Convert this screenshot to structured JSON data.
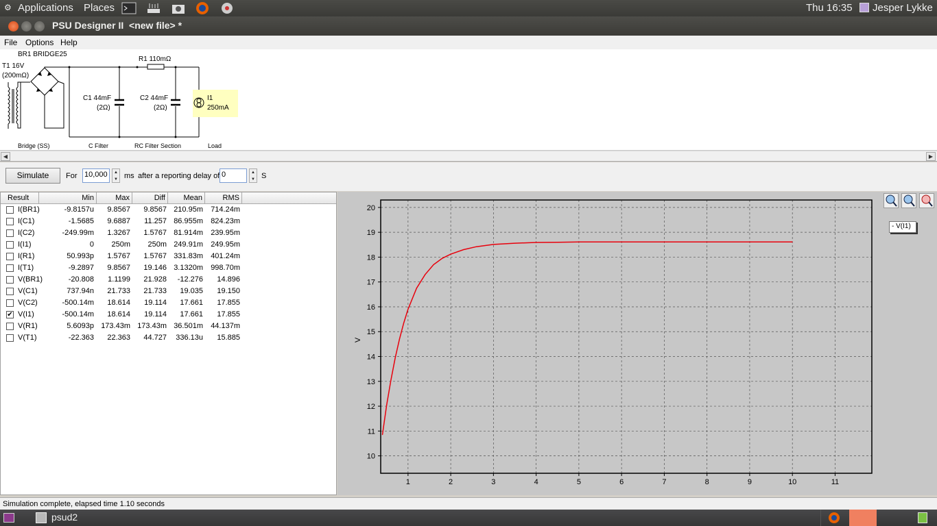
{
  "topbar": {
    "applications": "Applications",
    "places": "Places",
    "clock": "Thu 16:35",
    "user": "Jesper Lykke",
    "launchers": [
      "terminal-icon",
      "router-icon",
      "camera-icon",
      "firefox-icon",
      "gear-icon"
    ]
  },
  "window": {
    "title": "PSU Designer II  <new file> *"
  },
  "menu": {
    "file": "File",
    "options": "Options",
    "help": "Help"
  },
  "schematic": {
    "bridge_label": "BR1 BRIDGE25",
    "transformer_label": "T1 16V",
    "transformer_res": "(200mΩ)",
    "r1_label": "R1 110mΩ",
    "c1_label": "C1 44mF",
    "c1_res": "(2Ω)",
    "c2_label": "C2 44mF",
    "c2_res": "(2Ω)",
    "load_name": "I1",
    "load_value": "250mA",
    "section_bridge": "Bridge (SS)",
    "section_cfilter": "C Filter",
    "section_rc": "RC Filter Section",
    "section_load": "Load"
  },
  "sim": {
    "button": "Simulate",
    "for_label": "For",
    "duration": "10,000",
    "ms_label": "ms",
    "delay_label": "after a reporting delay of",
    "delay": "0",
    "s_label": "S"
  },
  "results": {
    "columns": [
      "Result",
      "Min",
      "Max",
      "Diff",
      "Mean",
      "RMS"
    ],
    "rows": [
      {
        "name": "I(BR1)",
        "min": "-9.8157u",
        "max": "9.8567",
        "diff": "9.8567",
        "mean": "210.95m",
        "rms": "714.24m",
        "checked": false
      },
      {
        "name": "I(C1)",
        "min": "-1.5685",
        "max": "9.6887",
        "diff": "11.257",
        "mean": "86.955m",
        "rms": "824.23m",
        "checked": false
      },
      {
        "name": "I(C2)",
        "min": "-249.99m",
        "max": "1.3267",
        "diff": "1.5767",
        "mean": "81.914m",
        "rms": "239.95m",
        "checked": false
      },
      {
        "name": "I(I1)",
        "min": "0",
        "max": "250m",
        "diff": "250m",
        "mean": "249.91m",
        "rms": "249.95m",
        "checked": false
      },
      {
        "name": "I(R1)",
        "min": "50.993p",
        "max": "1.5767",
        "diff": "1.5767",
        "mean": "331.83m",
        "rms": "401.24m",
        "checked": false
      },
      {
        "name": "I(T1)",
        "min": "-9.2897",
        "max": "9.8567",
        "diff": "19.146",
        "mean": "3.1320m",
        "rms": "998.70m",
        "checked": false
      },
      {
        "name": "V(BR1)",
        "min": "-20.808",
        "max": "1.1199",
        "diff": "21.928",
        "mean": "-12.276",
        "rms": "14.896",
        "checked": false
      },
      {
        "name": "V(C1)",
        "min": "737.94n",
        "max": "21.733",
        "diff": "21.733",
        "mean": "19.035",
        "rms": "19.150",
        "checked": false
      },
      {
        "name": "V(C2)",
        "min": "-500.14m",
        "max": "18.614",
        "diff": "19.114",
        "mean": "17.661",
        "rms": "17.855",
        "checked": false
      },
      {
        "name": "V(I1)",
        "min": "-500.14m",
        "max": "18.614",
        "diff": "19.114",
        "mean": "17.661",
        "rms": "17.855",
        "checked": true
      },
      {
        "name": "V(R1)",
        "min": "5.6093p",
        "max": "173.43m",
        "diff": "173.43m",
        "mean": "36.501m",
        "rms": "44.137m",
        "checked": false
      },
      {
        "name": "V(T1)",
        "min": "-22.363",
        "max": "22.363",
        "diff": "44.727",
        "mean": "336.13u",
        "rms": "15.885",
        "checked": false
      }
    ]
  },
  "graph": {
    "legend": "- V(I1)",
    "tools": [
      "zoom-in-icon",
      "zoom-out-icon",
      "zoom-reset-icon"
    ]
  },
  "chart_data": {
    "type": "line",
    "ylabel": "V",
    "xlabel": "",
    "xlim": [
      0.36,
      11.86
    ],
    "ylim": [
      9.3,
      20.3
    ],
    "xticks": [
      1,
      2,
      3,
      4,
      5,
      6,
      7,
      8,
      9,
      10,
      11
    ],
    "yticks": [
      10,
      11,
      12,
      13,
      14,
      15,
      16,
      17,
      18,
      19,
      20
    ],
    "grid": true,
    "line_color": "#e8000c",
    "series": [
      {
        "name": "V(I1)",
        "x": [
          0.4,
          0.5,
          0.6,
          0.7,
          0.8,
          0.9,
          1.0,
          1.2,
          1.4,
          1.6,
          1.8,
          2.0,
          2.3,
          2.6,
          3.0,
          3.5,
          4.0,
          4.5,
          5.0,
          6.0,
          7.0,
          8.0,
          9.0,
          10.0
        ],
        "y": [
          10.85,
          12.05,
          13.05,
          13.95,
          14.7,
          15.35,
          15.9,
          16.75,
          17.3,
          17.7,
          17.95,
          18.12,
          18.3,
          18.42,
          18.51,
          18.56,
          18.59,
          18.6,
          18.61,
          18.61,
          18.61,
          18.61,
          18.61,
          18.61
        ]
      }
    ]
  },
  "status": {
    "text": "Simulation complete, elapsed time 1.10 seconds"
  },
  "taskbar": {
    "app": "psud2"
  },
  "colors": {
    "plot_bg": "#c7c7c7",
    "trace": "#e8000c",
    "panel": "#3c3b37",
    "highlight": "#ffffc0"
  }
}
